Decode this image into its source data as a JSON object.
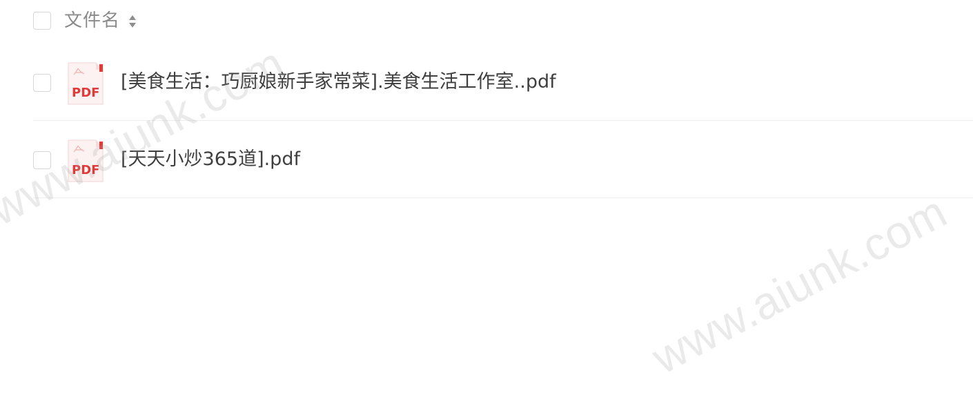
{
  "header": {
    "column_label": "文件名"
  },
  "files": [
    {
      "name": "[美食生活：巧厨娘新手家常菜].美食生活工作室..pdf",
      "icon_text": "PDF"
    },
    {
      "name": "[天天小炒365道].pdf",
      "icon_text": "PDF"
    }
  ],
  "watermarks": [
    "www.aiunk.com",
    "www.aiunk.com"
  ],
  "colors": {
    "pdf_red": "#e03b3b",
    "pdf_bg": "#fdf1f1",
    "text": "#3f3f3f",
    "header_text": "#8a8a8a"
  }
}
